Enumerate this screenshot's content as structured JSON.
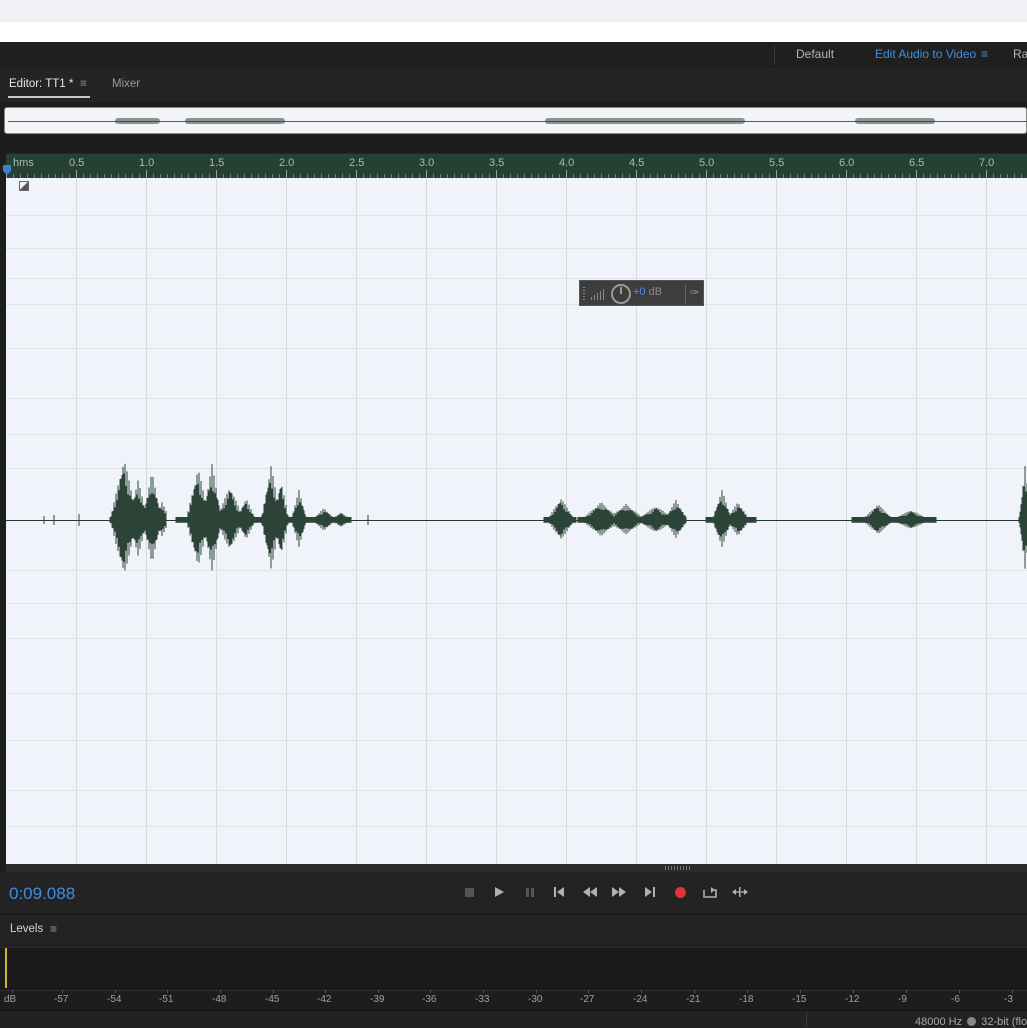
{
  "workspace": {
    "items": [
      "Default",
      "Edit Audio to Video",
      "Rad"
    ],
    "active": "Edit Audio to Video"
  },
  "editor": {
    "tabs": [
      "Editor: TT1 *",
      "Mixer"
    ],
    "active_tab": "Editor: TT1 *"
  },
  "ruler": {
    "start_label": "hms",
    "labels": [
      "0.5",
      "1.0",
      "1.5",
      "2.0",
      "2.5",
      "3.0",
      "3.5",
      "4.0",
      "4.5",
      "5.0",
      "5.5",
      "6.0",
      "6.5",
      "7.0"
    ]
  },
  "hud": {
    "value": "+0",
    "unit": "dB",
    "icons": [
      "volume-bars-icon",
      "knob-icon",
      "pin-icon"
    ]
  },
  "transport": {
    "timecode": "0:09.088",
    "buttons": [
      "stop",
      "play",
      "pause",
      "move-to-start",
      "rewind",
      "fast-forward",
      "move-to-end",
      "record",
      "loop",
      "skip-selection"
    ]
  },
  "levels": {
    "title": "Levels",
    "scale": [
      "dB",
      "-57",
      "-54",
      "-51",
      "-48",
      "-45",
      "-42",
      "-39",
      "-36",
      "-33",
      "-30",
      "-27",
      "-24",
      "-21",
      "-18",
      "-15",
      "-12",
      "-9",
      "-6",
      "-3"
    ]
  },
  "status": {
    "sample_rate": "48000 Hz",
    "bit_depth": "32-bit (flo"
  },
  "colors": {
    "accent": "#3d8fe0",
    "waveform": "#2c4437",
    "record": "#e0343a",
    "ruler": "#264034"
  }
}
